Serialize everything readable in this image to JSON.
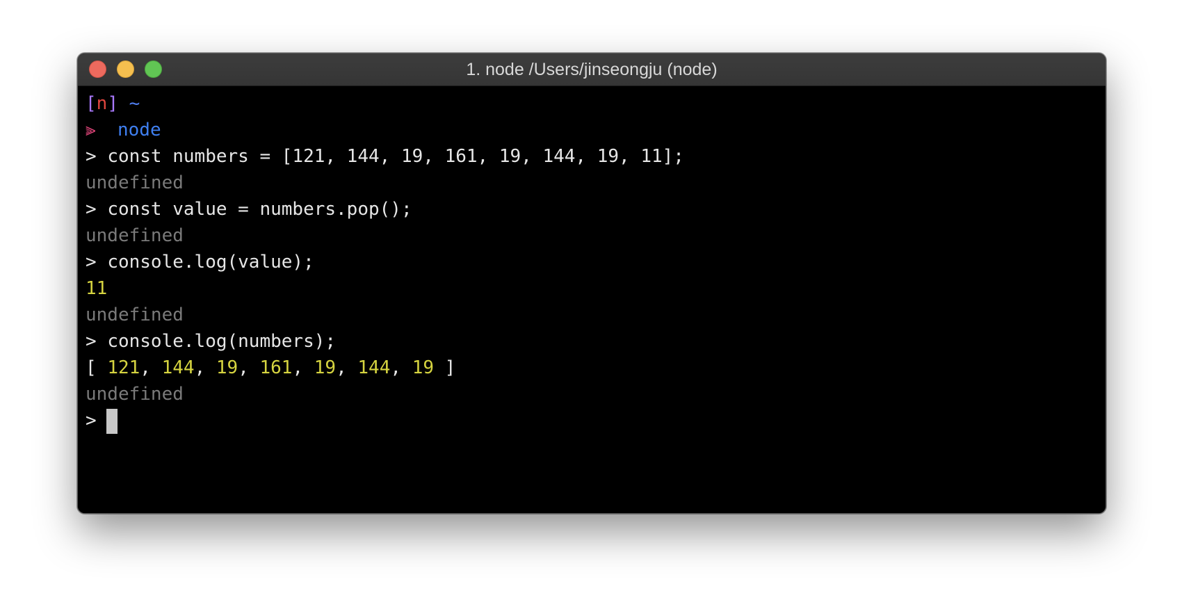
{
  "window": {
    "title": "1. node /Users/jinseongju (node)"
  },
  "prompt": {
    "bracket_open": "[",
    "n": "n",
    "bracket_close": "]",
    "tilde": "~",
    "arrow": "⫸",
    "command": "node"
  },
  "repl": {
    "prompt_symbol": ">",
    "lines": [
      {
        "type": "input",
        "text": "const numbers = [121, 144, 19, 161, 19, 144, 19, 11];"
      },
      {
        "type": "output-muted",
        "text": "undefined"
      },
      {
        "type": "input",
        "text": "const value = numbers.pop();"
      },
      {
        "type": "output-muted",
        "text": "undefined"
      },
      {
        "type": "input",
        "text": "console.log(value);"
      },
      {
        "type": "output-number",
        "text": "11"
      },
      {
        "type": "output-muted",
        "text": "undefined"
      },
      {
        "type": "input",
        "text": "console.log(numbers);"
      },
      {
        "type": "output-array",
        "open": "[",
        "close": "]",
        "values": [
          "121",
          "144",
          "19",
          "161",
          "19",
          "144",
          "19"
        ]
      },
      {
        "type": "output-muted",
        "text": "undefined"
      }
    ]
  },
  "colors": {
    "bracket": "#a979ff",
    "n_letter": "#e0463f",
    "tilde": "#4f7ef0",
    "arrow": "#e0457a",
    "command": "#3f7ff0",
    "muted": "#7a7a7a",
    "number": "#d6d440",
    "text": "#e6e6e6",
    "background": "#000000"
  }
}
